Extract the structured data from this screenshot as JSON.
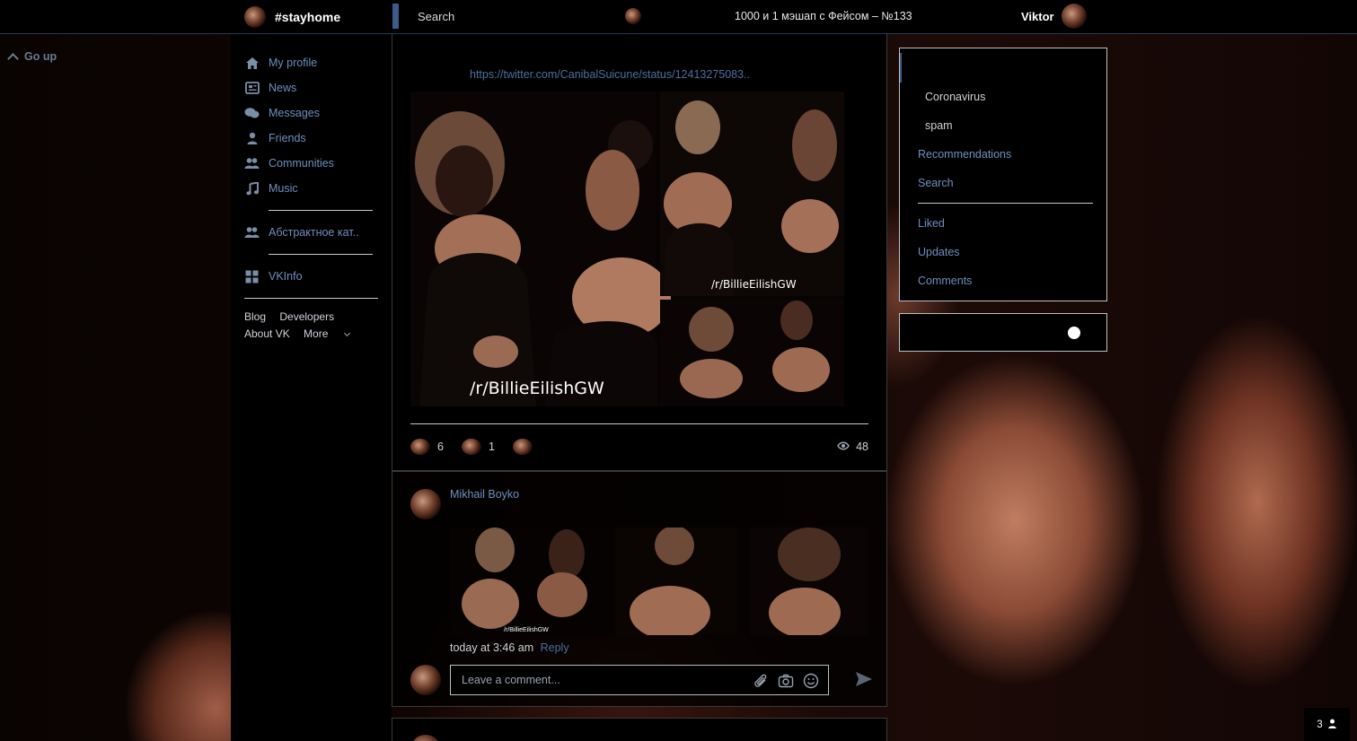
{
  "header": {
    "title": "#stayhome",
    "search_label": "Search",
    "now_playing": "1000 и 1 мэшап с Фейсом – №133",
    "user_name": "Viktor"
  },
  "go_up": {
    "label": "Go up"
  },
  "sidebar": {
    "items": [
      {
        "label": "My profile",
        "icon": "home-icon"
      },
      {
        "label": "News",
        "icon": "newspaper-icon"
      },
      {
        "label": "Messages",
        "icon": "chat-bubbles-icon"
      },
      {
        "label": "Friends",
        "icon": "person-icon"
      },
      {
        "label": "Communities",
        "icon": "group-icon"
      },
      {
        "label": "Music",
        "icon": "music-note-icon"
      }
    ],
    "group_item": {
      "label": "Абстрактное кат..",
      "icon": "group-icon"
    },
    "app_item": {
      "label": "VKInfo",
      "icon": "grid-icon"
    },
    "footer": {
      "blog": "Blog",
      "developers": "Developers",
      "about": "About VK",
      "more": "More"
    }
  },
  "post": {
    "link": "https://twitter.com/CanibalSuicune/status/12413275083..",
    "watermark_large": "/r/BillieEilishGW",
    "watermark_small": "/r/BillieEilishGW",
    "likes": "6",
    "comments": "1",
    "views": "48"
  },
  "comment": {
    "author": "Mikhail Boyko",
    "strip_watermark": "/r/BillieEilishGW",
    "time": "today at 3:46 am",
    "reply_label": "Reply",
    "input_placeholder": "Leave a comment..."
  },
  "right_menu": {
    "items": [
      {
        "label": "Coronavirus"
      },
      {
        "label": "spam"
      },
      {
        "label": "Recommendations"
      },
      {
        "label": "Search"
      }
    ],
    "items2": [
      {
        "label": "Liked"
      },
      {
        "label": "Updates"
      },
      {
        "label": "Comments"
      }
    ]
  },
  "chat": {
    "count": "3"
  },
  "colors": {
    "accent_link": "#6e8fbf",
    "accent_bar": "#3a5d8c",
    "background": "#000000",
    "text": "#cfd3d9"
  }
}
